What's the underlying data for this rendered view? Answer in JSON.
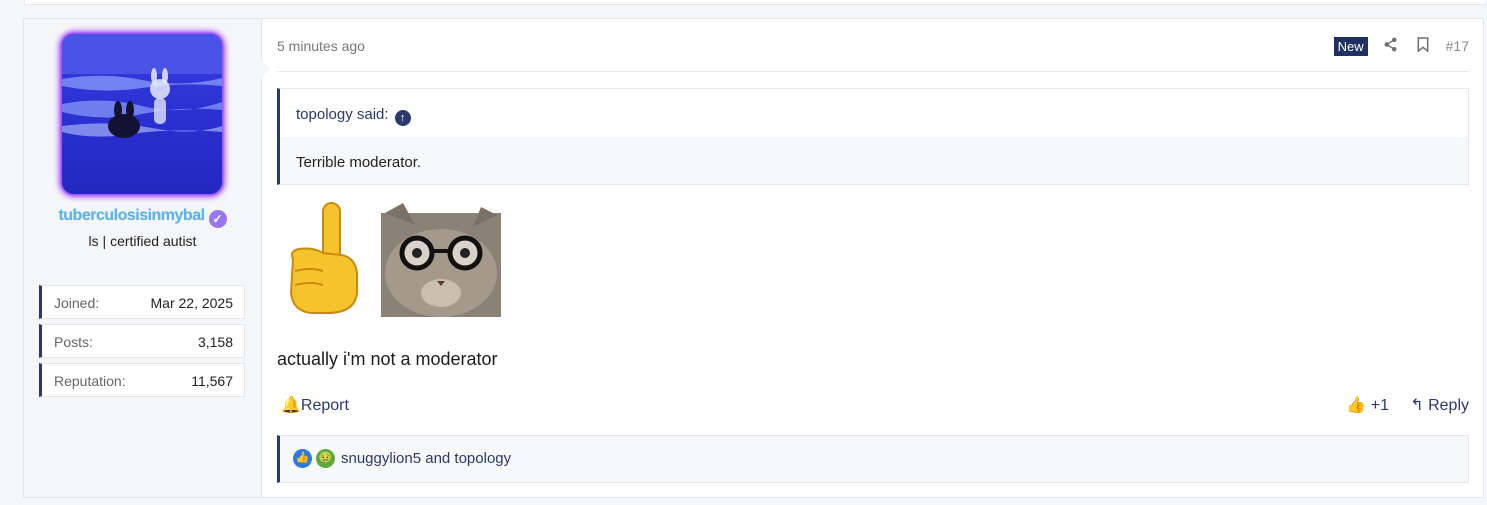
{
  "post": {
    "time": "5 minutes ago",
    "badge": "New",
    "number": "#17",
    "quote_author": "topology said:",
    "quote_text": "Terrible moderator.",
    "message": "actually i'm not a moderator",
    "report_label": "Report",
    "like_count": "+1",
    "reply_label": "Reply",
    "reactions_text": "snuggylion5 and topology"
  },
  "user": {
    "username": "tuberculosisinmybal",
    "title": "ls | certified autist",
    "stats": [
      {
        "key": "Joined:",
        "value": "Mar 22, 2025"
      },
      {
        "key": "Posts:",
        "value": "3,158"
      },
      {
        "key": "Reputation:",
        "value": "11,567"
      }
    ]
  },
  "icons": {
    "share": "share-icon",
    "bookmark": "bookmark-icon",
    "report": "bell-icon",
    "like": "thumbs-up-icon",
    "reply": "reply-arrow-icon",
    "quote_jump": "arrow-up-circle-icon",
    "verified": "verified-check-icon"
  },
  "colors": {
    "accent": "#2b3a6b",
    "badge_bg": "#1f3065",
    "username": "#5fb3e6",
    "avatar_glow": "#a64dff",
    "verified": "#9a77f0"
  }
}
